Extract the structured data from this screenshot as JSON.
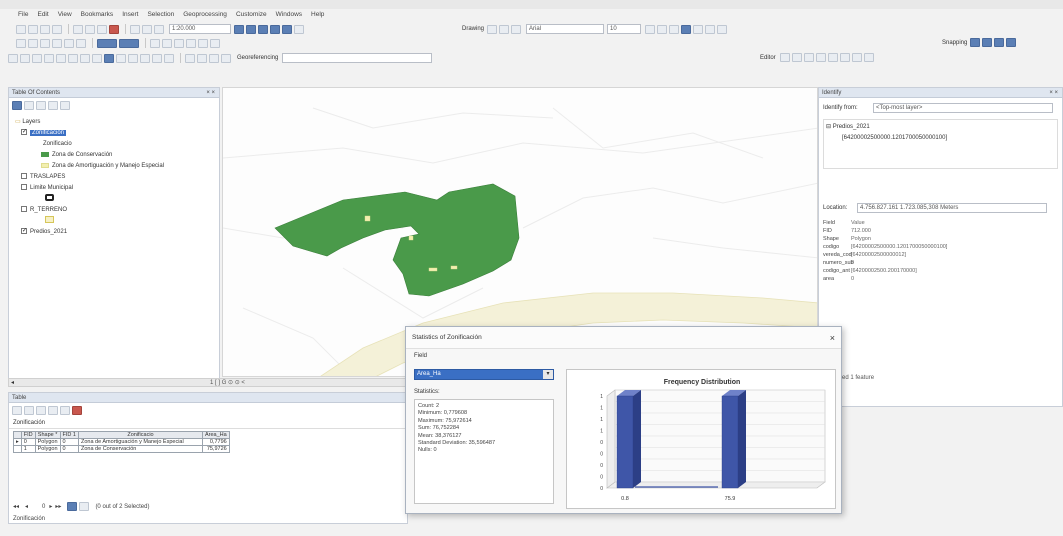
{
  "menu": [
    "File",
    "Edit",
    "View",
    "Bookmarks",
    "Insert",
    "Selection",
    "Geoprocessing",
    "Customize",
    "Windows",
    "Help"
  ],
  "toolbar": {
    "scale": "1:20.000",
    "drawing": "Drawing",
    "font": "Arial",
    "font_size": "10",
    "snapping": "Snapping",
    "geo": "Georeferencing",
    "editor": "Editor"
  },
  "toc": {
    "title": "Table Of Contents",
    "close": "× ×",
    "layers_label": "Layers",
    "items": [
      {
        "label": "Zonificación"
      },
      {
        "label": "Zonificacio"
      },
      {
        "label": "Zona de Conservación",
        "color": "#4a9a4a"
      },
      {
        "label": "Zona de Amortiguación y Manejo Especial",
        "color": "#f2efb0"
      },
      {
        "label": "TRASLAPES"
      },
      {
        "label": "Limite Municipal"
      },
      {
        "label": "R_TERRENO"
      },
      {
        "label": "Predios_2021"
      }
    ]
  },
  "identify": {
    "title": "Identify",
    "from_label": "Identify from:",
    "from_value": "<Top-most layer>",
    "tree_root": "Predios_2021",
    "tree_child": "[64200002500000.1201700050000100]",
    "location_label": "Location:",
    "location_value": "4.756.827.161  1.723.085,308 Meters",
    "field_header": "Field",
    "value_header": "Value",
    "rows": [
      {
        "k": "FID",
        "v": "712.000"
      },
      {
        "k": "Shape",
        "v": "Polygon"
      },
      {
        "k": "codigo",
        "v": "[64200002500000.1201700050000100]"
      },
      {
        "k": "vereda_cod",
        "v": "[64200002500000012]"
      },
      {
        "k": "numero_sub",
        "v": "0"
      },
      {
        "k": "codigo_ant",
        "v": "[64200002500.200170000]"
      },
      {
        "k": "area",
        "v": "0"
      }
    ],
    "footer": "dentified 1 feature"
  },
  "stats": {
    "title": "Statistics of Zonificación",
    "close": "×",
    "field_label": "Field",
    "field_value": "Area_Ha",
    "statistics_label": "Statistics:",
    "lines": [
      "Count:   2",
      "Minimum: 0,779608",
      "Maximum: 75,972614",
      "Sum:     76,752284",
      "Mean:    38,376127",
      "Standard Deviation: 35,596487",
      "Nulls:   0"
    ],
    "chart_title": "Frequency Distribution"
  },
  "chart_data": {
    "type": "bar",
    "title": "Frequency Distribution",
    "categories": [
      "0.8",
      "75.9"
    ],
    "values": [
      1,
      1
    ],
    "y_ticks": [
      "1",
      "1",
      "1",
      "1",
      "0",
      "0",
      "0",
      "0",
      "0"
    ],
    "ylim": [
      0,
      1
    ],
    "grid": true
  },
  "table": {
    "window_title": "Table",
    "tab": "Zonificación",
    "layer_name": "Zonificación",
    "headers": [
      "FID",
      "Shape *",
      "FID 1",
      "Zonificacio",
      "Area_Ha"
    ],
    "rows": [
      [
        "0",
        "Polygon",
        "0",
        "Zona de Amortiguación y Manejo Especial",
        "0,7796"
      ],
      [
        "1",
        "Polygon",
        "0",
        "Zona de Conservación",
        "75,9726"
      ]
    ],
    "status": "(0 out of 2 Selected)",
    "page": "0"
  },
  "map_scroll": "1 [ ] G  ⊙ ⊙ <",
  "colors": {
    "conservation": "#4a9a4a",
    "buffer": "#f2efb0",
    "bar": "#3f56a8",
    "selection": "#3a6fc4"
  }
}
